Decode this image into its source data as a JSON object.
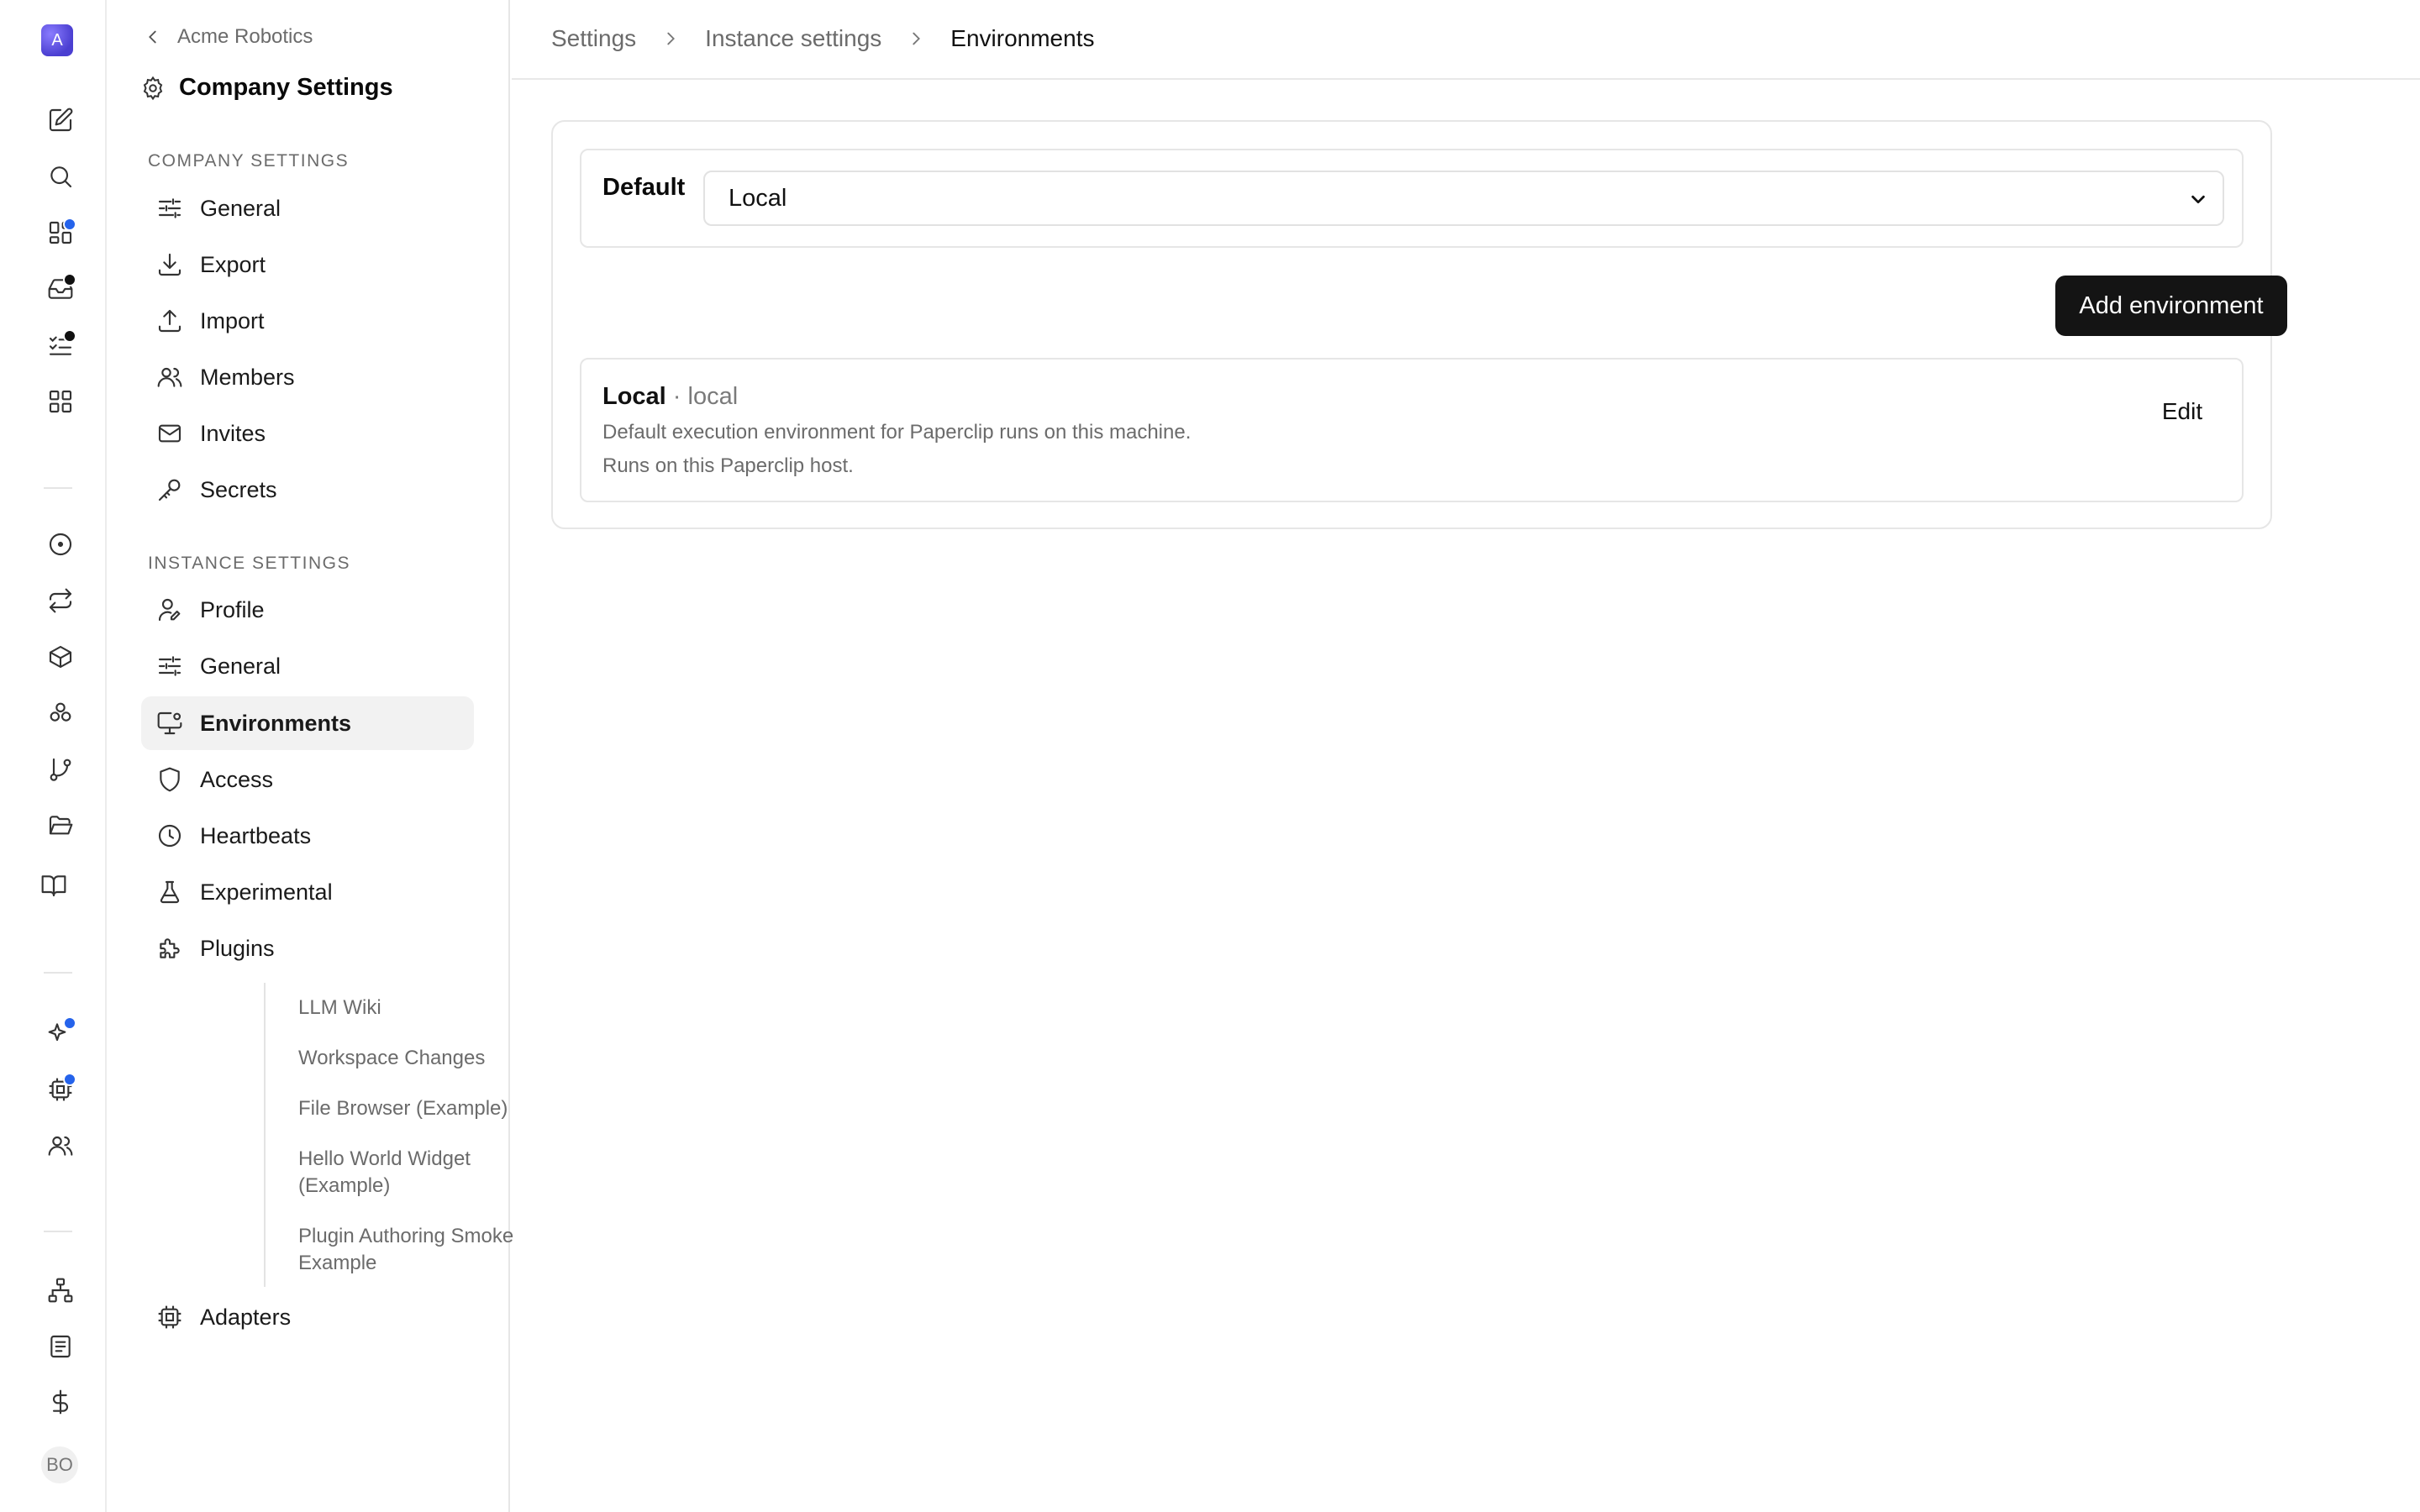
{
  "rail": {
    "logo_letter": "A",
    "avatar_initials": "BO",
    "dot_blue": "#2563eb",
    "dot_dark": "#111111"
  },
  "sidebar": {
    "back_label": "Acme Robotics",
    "title": "Company Settings",
    "company_section": "COMPANY SETTINGS",
    "company_items": [
      {
        "label": "General",
        "icon": "sliders-icon"
      },
      {
        "label": "Export",
        "icon": "download-icon"
      },
      {
        "label": "Import",
        "icon": "upload-icon"
      },
      {
        "label": "Members",
        "icon": "users-icon"
      },
      {
        "label": "Invites",
        "icon": "mail-icon"
      },
      {
        "label": "Secrets",
        "icon": "key-icon"
      }
    ],
    "instance_section": "INSTANCE SETTINGS",
    "instance_items": [
      {
        "label": "Profile",
        "icon": "user-pen-icon"
      },
      {
        "label": "General",
        "icon": "sliders-icon"
      },
      {
        "label": "Environments",
        "icon": "monitor-cog-icon",
        "active": true
      },
      {
        "label": "Access",
        "icon": "shield-icon"
      },
      {
        "label": "Heartbeats",
        "icon": "clock-icon"
      },
      {
        "label": "Experimental",
        "icon": "flask-icon"
      },
      {
        "label": "Plugins",
        "icon": "puzzle-icon"
      }
    ],
    "plugin_items": [
      "LLM Wiki",
      "Workspace Changes",
      "File Browser (Example)",
      "Hello World Widget (Example)",
      "Plugin Authoring Smoke Example"
    ],
    "adapters_label": "Adapters"
  },
  "breadcrumb": {
    "items": [
      "Settings",
      "Instance settings",
      "Environments"
    ]
  },
  "environments": {
    "default_label": "Default",
    "default_value": "Local",
    "add_button": "Add environment",
    "list": [
      {
        "name": "Local",
        "kind": "local",
        "separator": " · ",
        "description": "Default execution environment for Paperclip runs on this machine.",
        "host_note": "Runs on this Paperclip host.",
        "edit_label": "Edit"
      }
    ]
  }
}
